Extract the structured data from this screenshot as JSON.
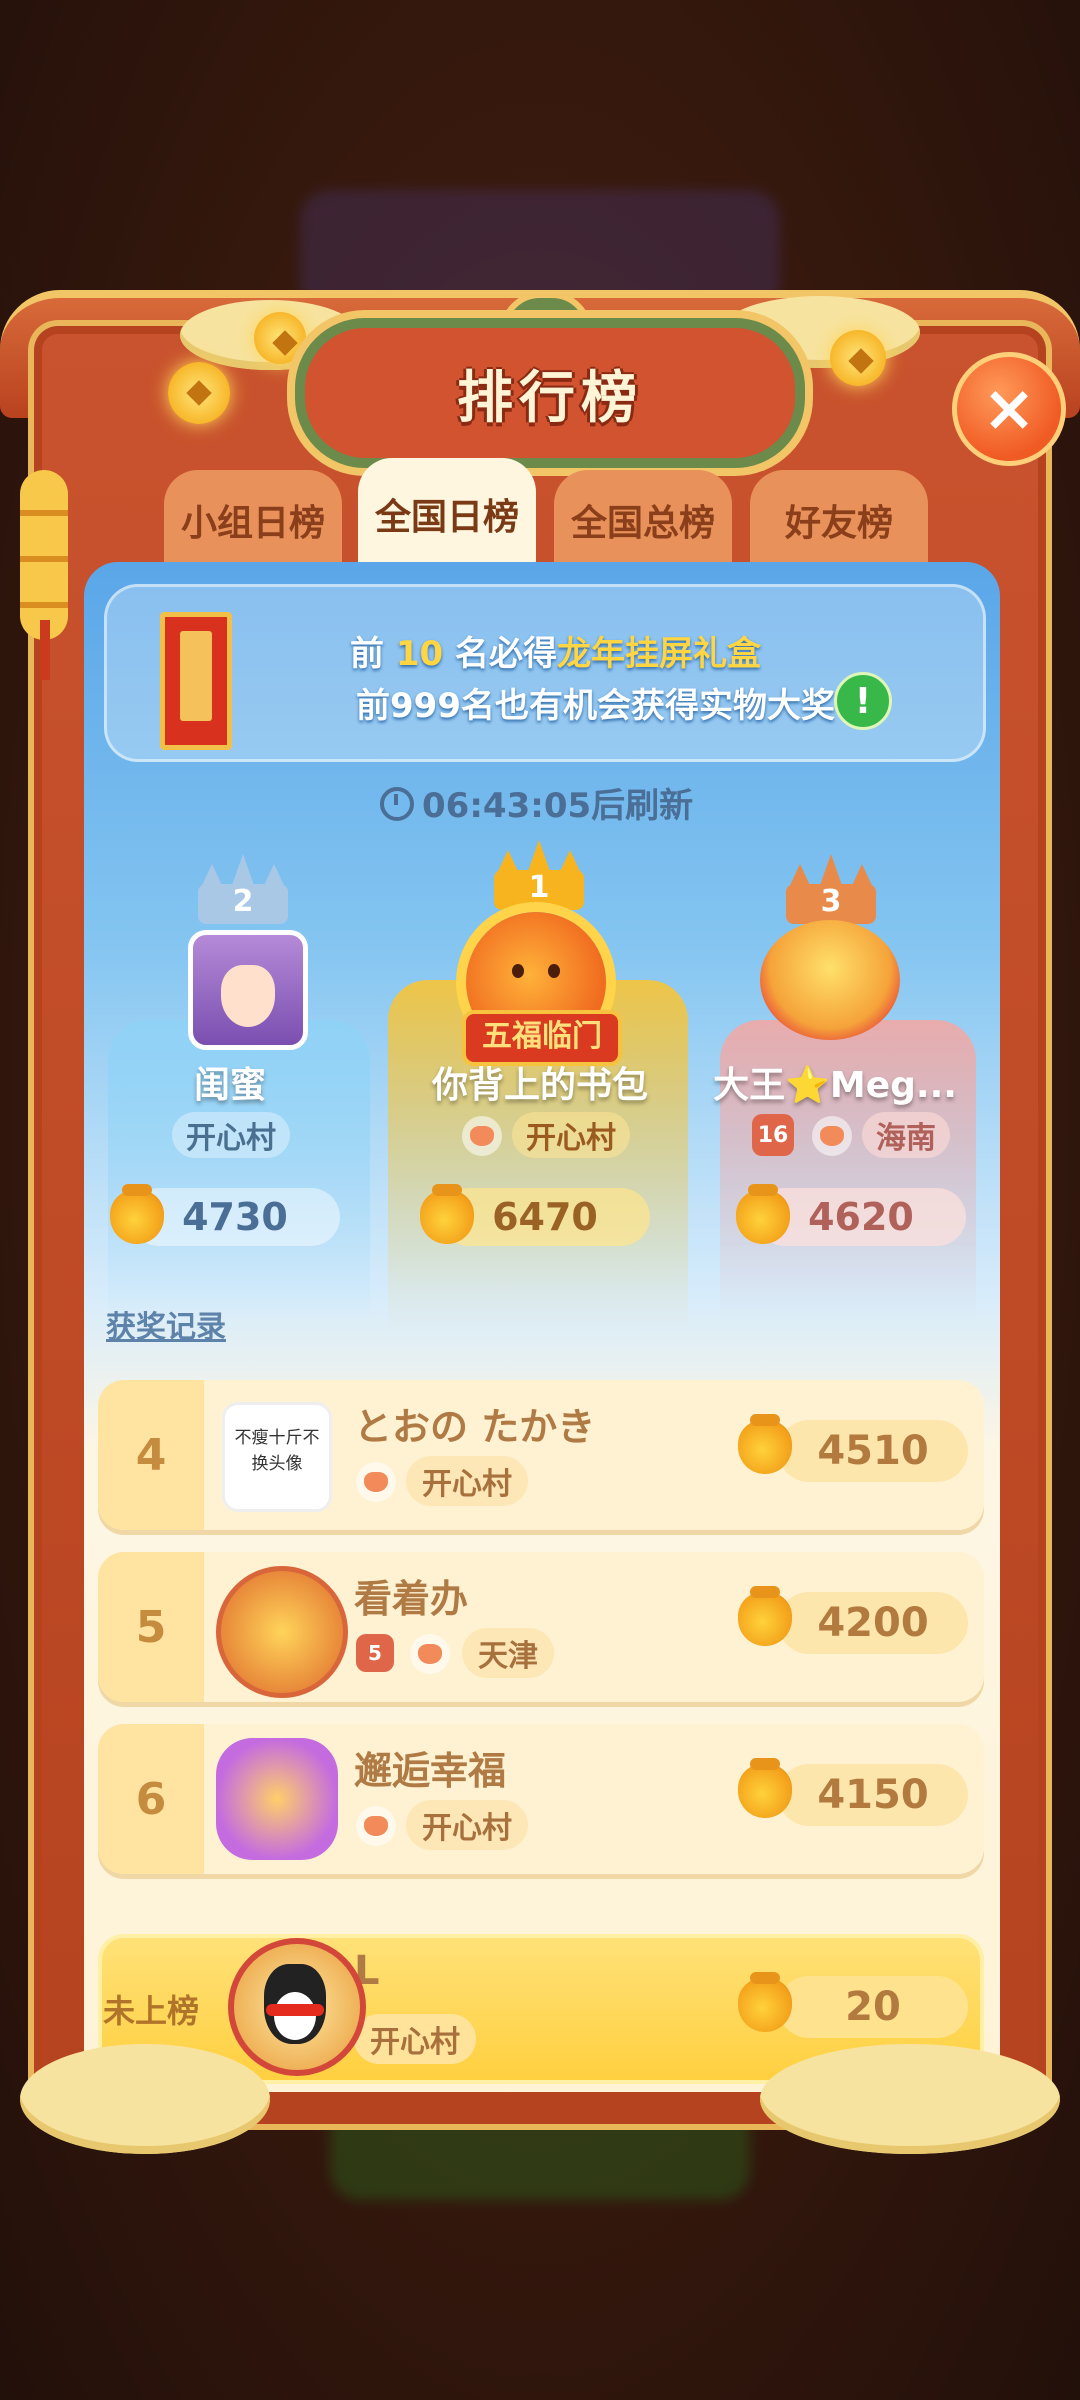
{
  "dialog": {
    "title": "排行榜",
    "close_label": "×"
  },
  "tabs": [
    {
      "label": "小组日榜",
      "active": false
    },
    {
      "label": "全国日榜",
      "active": true
    },
    {
      "label": "全国总榜",
      "active": false
    },
    {
      "label": "好友榜",
      "active": false
    }
  ],
  "banner": {
    "line1_prefix": "前 ",
    "line1_number": "10",
    "line1_middle": " 名必得",
    "line1_prize": "龙年挂屏礼盒",
    "line2": "前999名也有机会获得实物大奖",
    "info_label": "!"
  },
  "timer": {
    "text": "06:43:05后刷新"
  },
  "podium": [
    {
      "rank": "2",
      "name": "闺蜜",
      "village": "开心村",
      "score": "4730"
    },
    {
      "rank": "1",
      "name": "你背上的书包",
      "village": "开心村",
      "score": "6470",
      "frame_text": "五福临门"
    },
    {
      "rank": "3",
      "name": "大王⭐Meg...",
      "level": "16",
      "village": "海南",
      "score": "4620"
    }
  ],
  "award_record_link": "获奖记录",
  "rows": [
    {
      "rank": "4",
      "name": "とおの たかき",
      "village": "开心村",
      "score": "4510",
      "avatar_text": "不瘦十斤不换头像"
    },
    {
      "rank": "5",
      "name": "看着办",
      "level": "5",
      "village": "天津",
      "score": "4200"
    },
    {
      "rank": "6",
      "name": "邂逅幸福",
      "village": "开心村",
      "score": "4150"
    }
  ],
  "me": {
    "rank": "未上榜",
    "name": "L",
    "village": "开心村",
    "score": "20"
  },
  "colors": {
    "accent_red": "#c9532e",
    "gold": "#ffd542",
    "sky": "#5aa6e8"
  }
}
